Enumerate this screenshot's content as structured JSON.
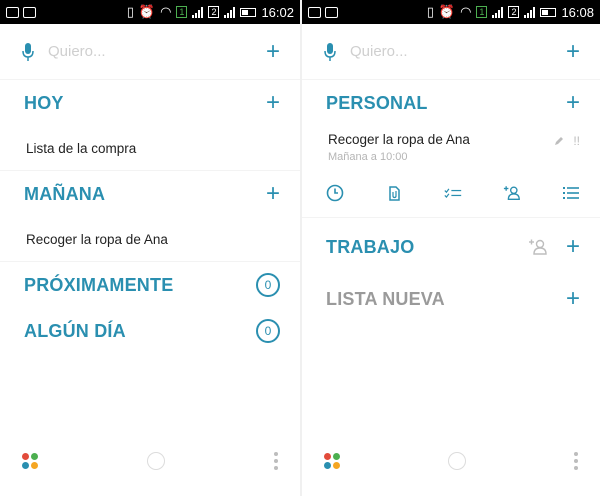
{
  "colors": {
    "accent": "#2a8fb0",
    "gray_title": "#9a9a9a",
    "dot_red": "#e24b3b",
    "dot_green": "#4caf50",
    "dot_blue": "#2a8fb0",
    "dot_orange": "#f5a623"
  },
  "left": {
    "status_time": "16:02",
    "search_placeholder": "Quiero...",
    "sections": [
      {
        "title": "HOY",
        "task": "Lista de la compra"
      },
      {
        "title": "MAÑANA",
        "task": "Recoger la ropa de Ana"
      },
      {
        "title": "PRÓXIMAMENTE",
        "count": "0"
      },
      {
        "title": "ALGÚN DÍA",
        "count": "0"
      }
    ]
  },
  "right": {
    "status_time": "16:08",
    "search_placeholder": "Quiero...",
    "personal": {
      "title": "PERSONAL",
      "task": "Recoger la ropa de Ana",
      "task_sub": "Mañana a 10:00",
      "priority": "!!"
    },
    "trabajo": {
      "title": "TRABAJO"
    },
    "nueva": {
      "title": "LISTA NUEVA"
    }
  },
  "icons": [
    "mic-icon",
    "plus-icon",
    "clock-icon",
    "attachment-icon",
    "checklist-icon",
    "add-person-icon",
    "list-icon",
    "pencil-icon",
    "apps-icon",
    "home-circle-icon",
    "more-vert-icon"
  ]
}
